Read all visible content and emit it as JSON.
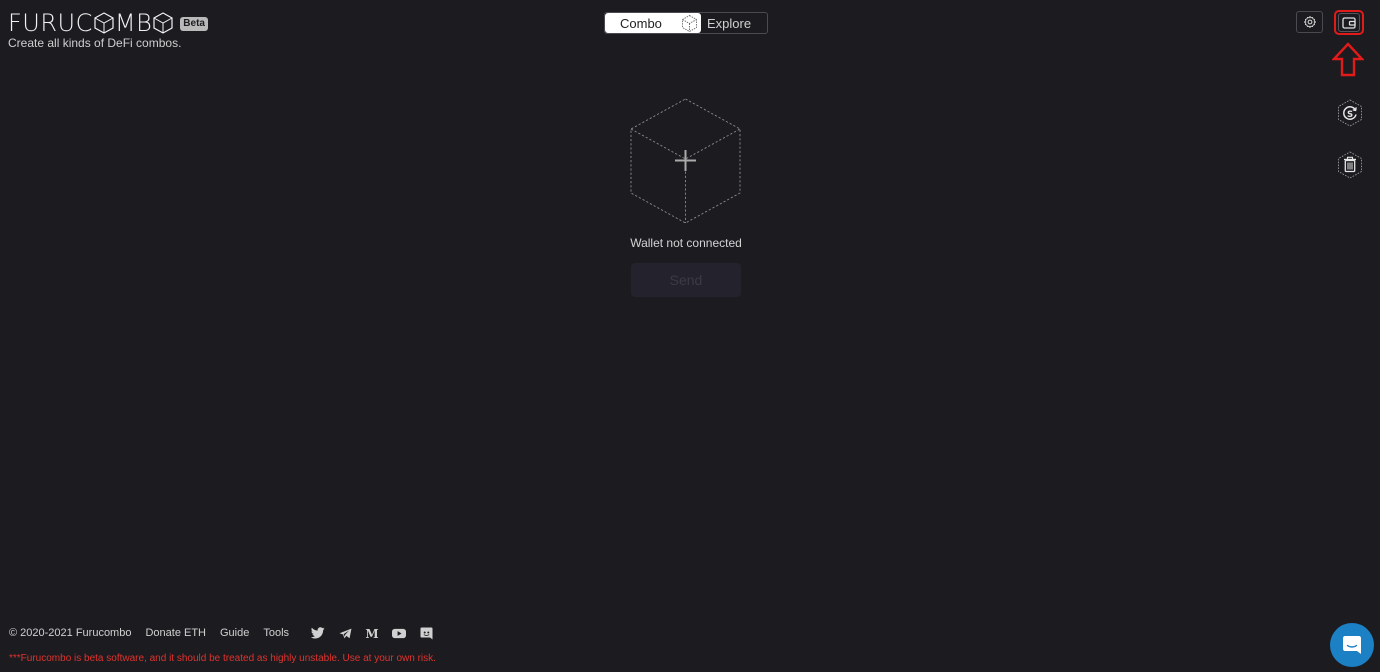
{
  "brand": {
    "name_before": "FURUC",
    "name_after": "MB",
    "beta": "Beta",
    "tagline": "Create all kinds of DeFi combos."
  },
  "mode_toggle": {
    "combo_label": "Combo",
    "explore_label": "Explore",
    "active": "Combo"
  },
  "header_actions": {
    "settings_icon": "gear-icon",
    "wallet_icon": "wallet-icon"
  },
  "sidebar_actions": [
    {
      "icon": "sync-coin-icon"
    },
    {
      "icon": "trash-icon"
    }
  ],
  "main": {
    "empty_icon": "add-cube-icon",
    "status": "Wallet not connected",
    "send_label": "Send"
  },
  "footer": {
    "copyright": "© 2020-2021 Furucombo",
    "links": [
      "Donate ETH",
      "Guide",
      "Tools"
    ],
    "social": [
      "twitter-icon",
      "telegram-icon",
      "medium-icon",
      "youtube-icon",
      "discord-icon"
    ],
    "disclaimer": "***Furucombo is beta software, and it should be treated as highly unstable. Use at your own risk."
  },
  "colors": {
    "background": "#1c1b20",
    "highlight": "#e11a1a",
    "chat": "#1b80c4",
    "disclaimer": "#e0332d"
  }
}
